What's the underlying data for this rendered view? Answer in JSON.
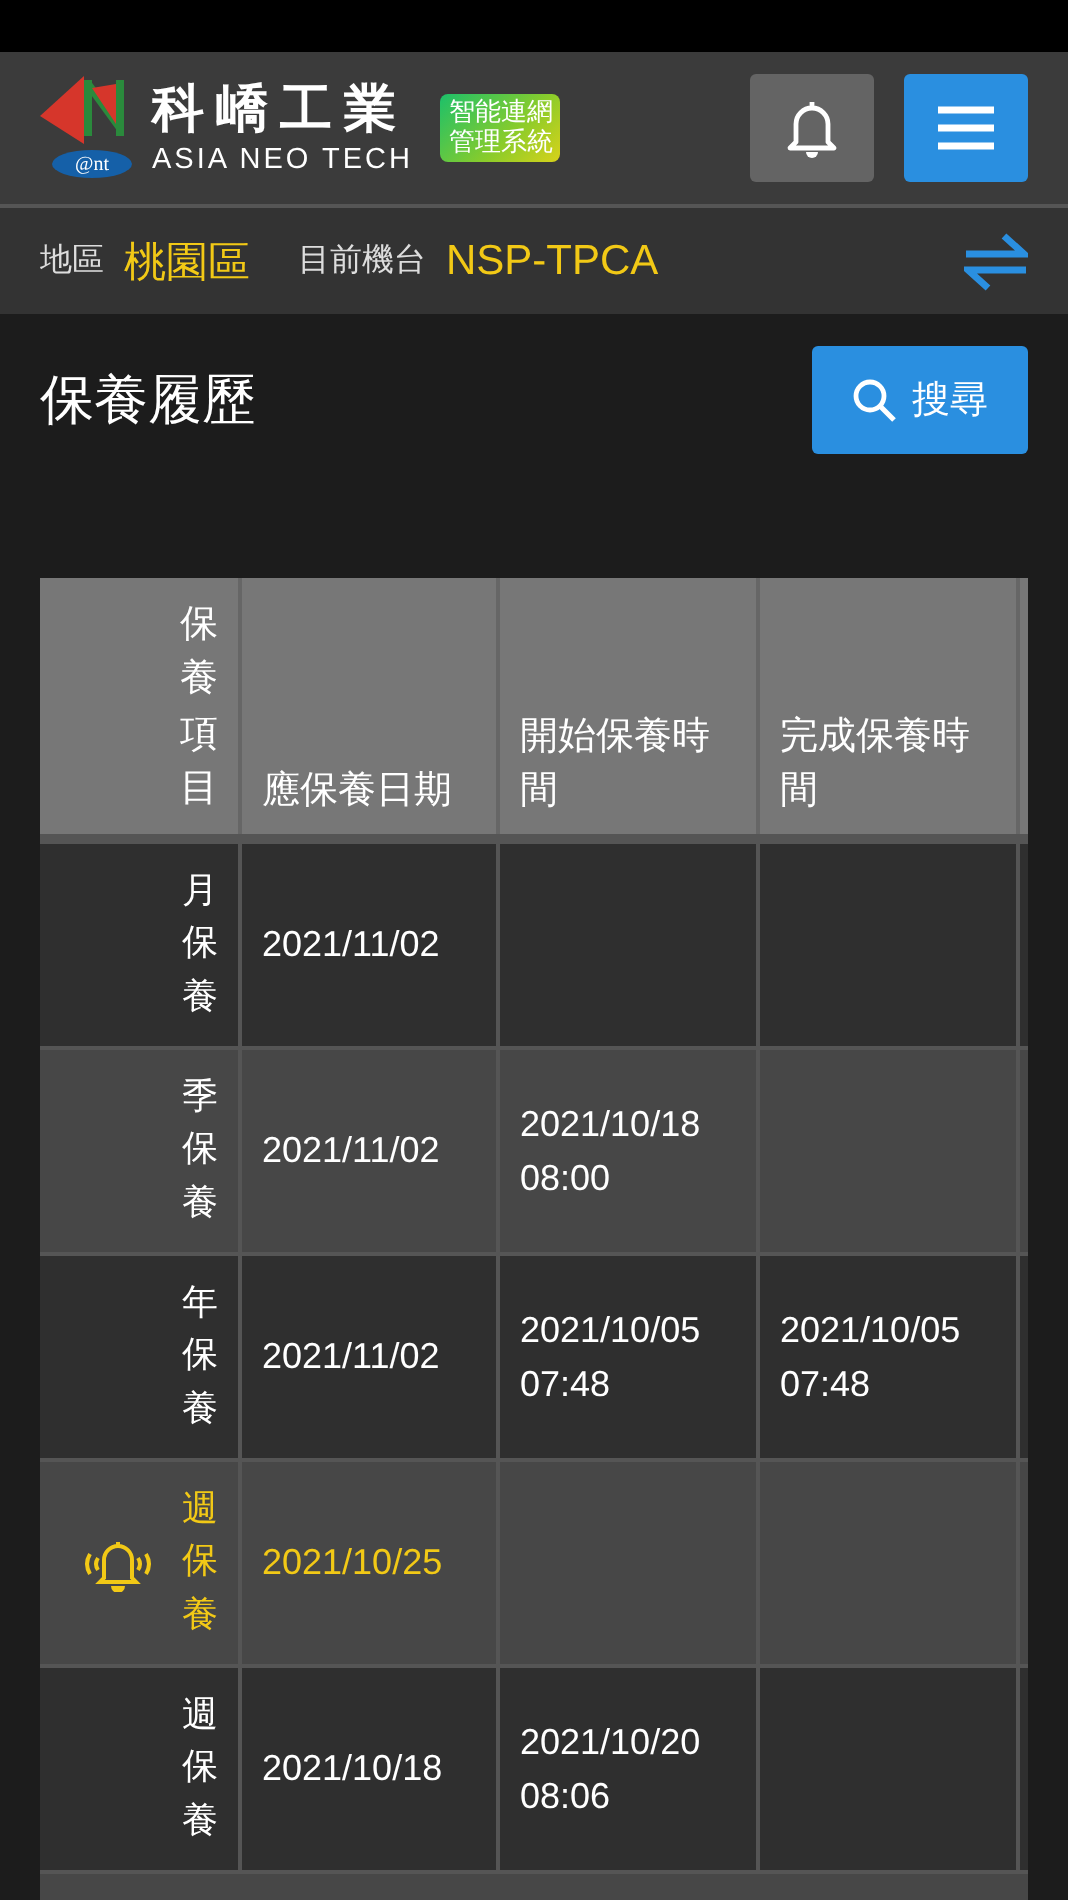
{
  "header": {
    "logo_mark": "@nt",
    "brand": "科嶠工業",
    "brand_en": "ASIA NEO TECH",
    "badge_lines": [
      "智能連網",
      "管理系統"
    ]
  },
  "info_bar": {
    "region_label": "地區",
    "region": "桃園區",
    "machine_label": "目前機台",
    "machine": "NSP-TPCA"
  },
  "page": {
    "title": "保養履歷",
    "search_button": "搜尋"
  },
  "table": {
    "columns": [
      "保養項目",
      "應保養日期",
      "開始保養時間",
      "完成保養時間"
    ],
    "rows": [
      {
        "item": "月保養",
        "due_date": "2021/11/02",
        "start": "",
        "finish": "",
        "alert": false
      },
      {
        "item": "季保養",
        "due_date": "2021/11/02",
        "start": "2021/10/18 08:00",
        "finish": "",
        "alert": false
      },
      {
        "item": "年保養",
        "due_date": "2021/11/02",
        "start": "2021/10/05 07:48",
        "finish": "2021/10/05 07:48",
        "alert": false
      },
      {
        "item": "週保養",
        "due_date": "2021/10/25",
        "start": "",
        "finish": "",
        "alert": true
      },
      {
        "item": "週保養",
        "due_date": "2021/10/18",
        "start": "2021/10/20 08:06",
        "finish": "",
        "alert": false
      }
    ]
  }
}
